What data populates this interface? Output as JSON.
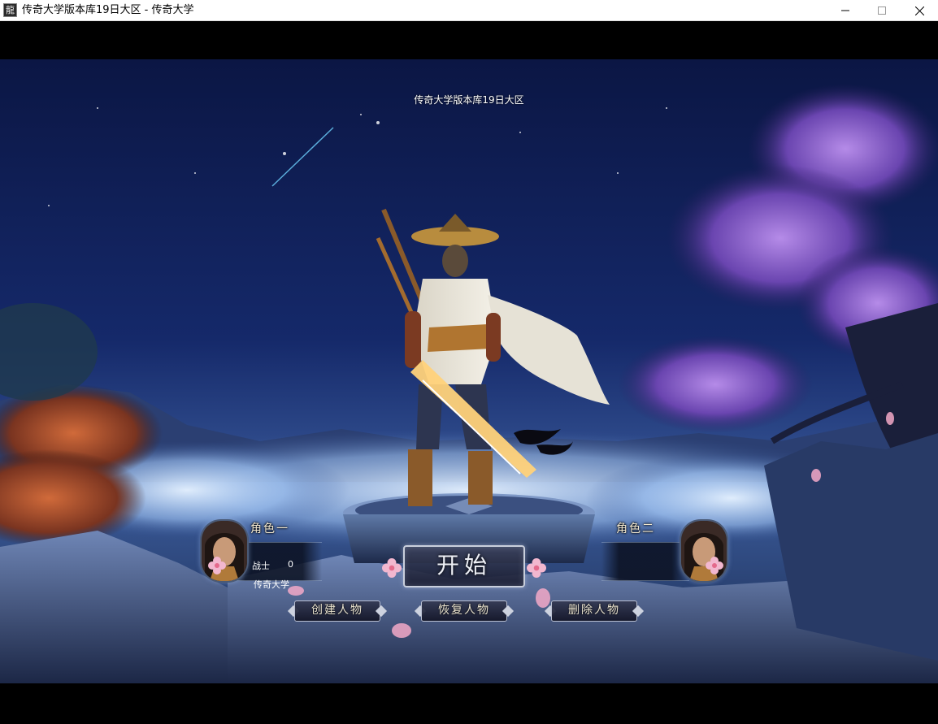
{
  "window": {
    "title": "传奇大学版本库19日大区 - 传奇大学",
    "icon_glyph": "龍",
    "controls": [
      "minimize-icon",
      "maximize-icon",
      "close-icon"
    ]
  },
  "scene": {
    "server_name": "传奇大学版本库19日大区"
  },
  "slots": {
    "left": {
      "label": "角色一",
      "class": "战士",
      "level": "0",
      "name": "传奇大学"
    },
    "right": {
      "label": "角色二"
    }
  },
  "buttons": {
    "start": "开始",
    "create": "创建人物",
    "restore": "恢复人物",
    "delete": "删除人物"
  },
  "colors": {
    "sky": "#0c1a4a",
    "mist": "#b9d4ff",
    "blossom": "#7a4fc2",
    "label_text": "#f1e7cf"
  }
}
